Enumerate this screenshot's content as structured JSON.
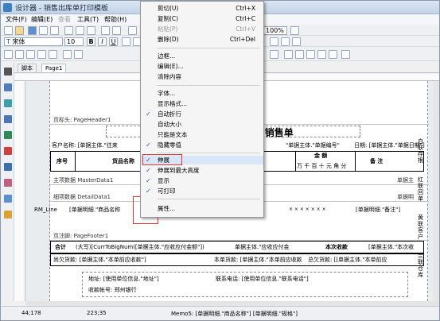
{
  "app": {
    "title": "设计器 - 销售出库单打印模板"
  },
  "menu": [
    {
      "label": "文件(F)",
      "disabled": false
    },
    {
      "label": "编辑(E)",
      "disabled": false
    },
    {
      "label": "查看",
      "disabled": true
    },
    {
      "label": "工具(T)",
      "disabled": false
    },
    {
      "label": "帮助(H)",
      "disabled": false
    }
  ],
  "toolbar": {
    "zoom": "100%",
    "font_name": "宋体",
    "font_size": "10",
    "bold": "B",
    "italic": "I",
    "underline": "U"
  },
  "tabs": [
    {
      "label": "脚本"
    },
    {
      "label": "Page1"
    }
  ],
  "context_menu": {
    "items": [
      {
        "label": "剪切(U)",
        "shortcut": "Ctrl+X",
        "checked": false,
        "disabled": false
      },
      {
        "label": "复制(C)",
        "shortcut": "Ctrl+C",
        "checked": false,
        "disabled": false
      },
      {
        "label": "粘贴(P)",
        "shortcut": "Ctrl+V",
        "checked": false,
        "disabled": true
      },
      {
        "label": "删除(D)",
        "shortcut": "Ctrl+Del",
        "checked": false,
        "disabled": false
      },
      {
        "label": "边框...",
        "shortcut": "",
        "checked": false,
        "disabled": false
      },
      {
        "label": "编辑(E)...",
        "shortcut": "",
        "checked": false,
        "disabled": false
      },
      {
        "label": "清除内容",
        "shortcut": "",
        "checked": false,
        "disabled": false
      },
      {
        "label": "字体...",
        "shortcut": "",
        "checked": false,
        "disabled": false
      },
      {
        "label": "显示格式...",
        "shortcut": "",
        "checked": false,
        "disabled": false
      },
      {
        "label": "自动折行",
        "shortcut": "",
        "checked": true,
        "disabled": false
      },
      {
        "label": "自动大小",
        "shortcut": "",
        "checked": false,
        "disabled": false
      },
      {
        "label": "只能是文本",
        "shortcut": "",
        "checked": false,
        "disabled": false
      },
      {
        "label": "隐藏零值",
        "shortcut": "",
        "checked": true,
        "disabled": false
      },
      {
        "label": "伸展",
        "shortcut": "",
        "checked": true,
        "disabled": false
      },
      {
        "label": "伸展到最大高度",
        "shortcut": "",
        "checked": true,
        "disabled": false
      },
      {
        "label": "显示",
        "shortcut": "",
        "checked": true,
        "disabled": false
      },
      {
        "label": "可打印",
        "shortcut": "",
        "checked": true,
        "disabled": false
      },
      {
        "label": "属性...",
        "shortcut": "",
        "checked": false,
        "disabled": false
      }
    ]
  },
  "report": {
    "page_header_label": "页标头: PageHeader1",
    "title_suffix": "称\"]销售单",
    "customer_label": "客户名称: [单据主体.\"往来",
    "docno_text": "\"单据主体.\"单据编号\"",
    "date_text": "日期: [单据主体.\"单据日期\"]",
    "col_seq": "序号",
    "col_goods": "货品名称",
    "col_amount": "金 额",
    "amount_digits": "万 千 百 十 元 角 分",
    "col_remark": "备  注",
    "master_band": "主项数据 MasterData1",
    "master_right": "单据主",
    "detail_band": "细项数据 DetailData1",
    "detail_cell1": "RM_Line",
    "detail_cell2": "[单据明细.\"商品名称",
    "detail_cell3": "[单据明细.\"备注\"]",
    "detail_right": "单据明",
    "stars": "× × × × × × ×",
    "footer_band": "页注脚: PageFooter1",
    "sum_label": "合计",
    "sum_upper": "(大写)[CurrToBigNum([单据主体.\"应收应付金额\"])",
    "sum_main": "单据主体.\"应收应付金",
    "sum_current": "本次收款",
    "sum_current_val": "[单据主体.\"本次收",
    "prev_owe": "尚欠货款: [单据主体.\"本单前应收款\"]",
    "this_owe": "本单货款: [单据主体.\"本单前应收款",
    "total_owe": "总欠货款: [[单据主体.\"本单前应",
    "addr": "地址: [使用单位信息.\"地址\"]",
    "phone": "联系电话: [使用单位信息.\"联系电话\"]",
    "bank": "收款帐号: 郑州银行",
    "side_labels": [
      "白联存根",
      "红联回单",
      "黄联客户",
      "兰联仓库"
    ]
  },
  "status": {
    "pos1": "44;178",
    "pos2": "223;35",
    "memo": "Memo5: [单据明细.\"商品名称\"] [单据明细.\"规格\"]"
  }
}
